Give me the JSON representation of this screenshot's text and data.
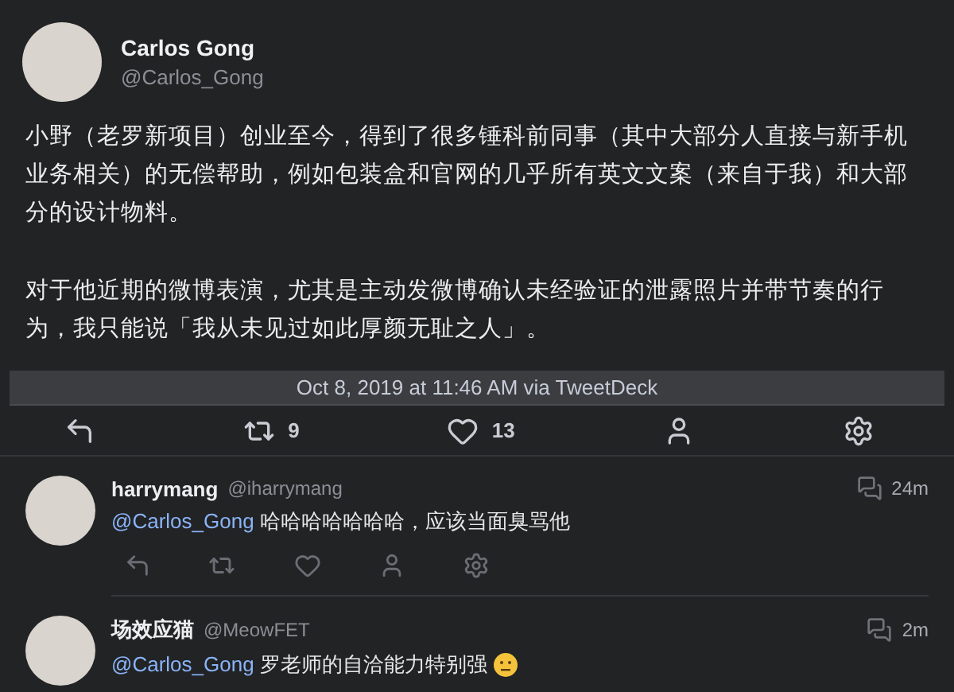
{
  "tweet": {
    "author": {
      "name": "Carlos Gong",
      "handle": "@Carlos_Gong"
    },
    "paragraphs": [
      "小野（老罗新项目）创业至今，得到了很多锤科前同事（其中大部分人直接与新手机业务相关）的无偿帮助，例如包装盒和官网的几乎所有英文文案（来自于我）和大部分的设计物料。",
      "对于他近期的微博表演，尤其是主动发微博确认未经验证的泄露照片并带节奏的行为，我只能说「我从未见过如此厚颜无耻之人」。"
    ],
    "timestamp": "Oct 8, 2019 at 11:46 AM via TweetDeck",
    "actions": [
      {
        "kind": "reply"
      },
      {
        "kind": "retweet",
        "count": "9"
      },
      {
        "kind": "like",
        "count": "13"
      },
      {
        "kind": "profile"
      },
      {
        "kind": "settings"
      }
    ]
  },
  "replies": [
    {
      "name": "harrymang",
      "handle": "@iharrymang",
      "time": "24m",
      "mention": "@Carlos_Gong",
      "text": "哈哈哈哈哈哈哈，应该当面臭骂他",
      "show_actions": true,
      "emoji": false
    },
    {
      "name": "场效应猫",
      "handle": "@MeowFET",
      "time": "2m",
      "mention": "@Carlos_Gong",
      "text": "罗老师的自洽能力特别强",
      "show_actions": false,
      "emoji": true
    }
  ]
}
